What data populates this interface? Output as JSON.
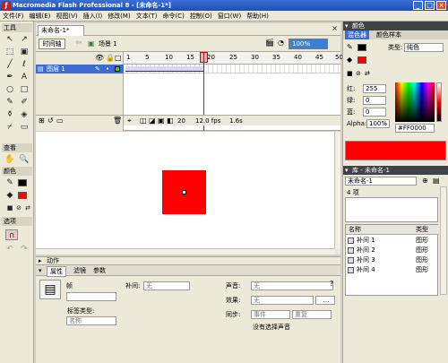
{
  "window": {
    "title": "Macromedia Flash Professional 8 - [未命名-1*]"
  },
  "menu": [
    "文件(F)",
    "编辑(E)",
    "视图(V)",
    "插入(I)",
    "修改(M)",
    "文本(T)",
    "命令(C)",
    "控制(O)",
    "窗口(W)",
    "帮助(H)"
  ],
  "tools": {
    "title": "工具",
    "view_title": "查看",
    "color_title": "颜色",
    "options_title": "选项"
  },
  "doc": {
    "tab": "未命名-1*",
    "timeline_btn": "时间轴",
    "scene": "场景 1",
    "zoom": "100%"
  },
  "timeline": {
    "frame_ticks": [
      "1",
      "5",
      "10",
      "15",
      "20",
      "25",
      "30",
      "35",
      "40",
      "45",
      "50"
    ],
    "layer_name": "图层 1",
    "current_frame": "20",
    "fps": "12.0 fps",
    "time": "1.6s"
  },
  "panels": {
    "actions": "动作",
    "props_tab": "属性",
    "filters_tab": "滤镜",
    "params_tab": "参数"
  },
  "props": {
    "frame_label": "帧",
    "tween_label": "补间:",
    "tween_value": "无",
    "sound_label": "声音:",
    "sound_value": "无",
    "effect_label": "效果:",
    "effect_value": "无",
    "label_type_label": "标签类型:",
    "label_type_value": "名称",
    "sync_label": "同步:",
    "sync_value": "事件",
    "repeat_value": "重复",
    "no_sound": "没有选择声音"
  },
  "color_panel": {
    "title": "颜色",
    "tab_mixer": "混色器",
    "tab_swatches": "颜色样本",
    "type_label": "类型:",
    "type_value": "纯色",
    "r_label": "红:",
    "r_value": "255",
    "g_label": "绿:",
    "g_value": "0",
    "b_label": "蓝:",
    "b_value": "0",
    "alpha_label": "Alpha:",
    "alpha_value": "100%",
    "hex_value": "#FF0000",
    "color": "#ff0000"
  },
  "library": {
    "title": "库 - 未命名-1",
    "doc_select": "未命名-1",
    "count": "4 项",
    "col_name": "名称",
    "col_type": "类型",
    "items": [
      {
        "name": "补间 1",
        "type": "图形"
      },
      {
        "name": "补间 2",
        "type": "图形"
      },
      {
        "name": "补间 3",
        "type": "图形"
      },
      {
        "name": "补间 4",
        "type": "图形"
      }
    ]
  }
}
